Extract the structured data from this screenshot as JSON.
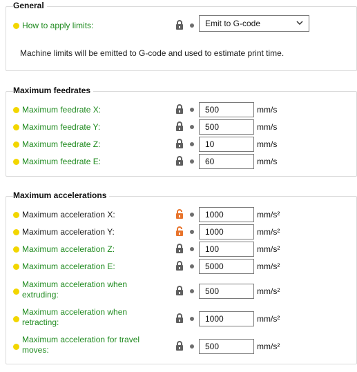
{
  "general": {
    "title": "General",
    "apply_limits_label": "How to apply limits:",
    "apply_limits_value": "Emit to G-code",
    "info_text": "Machine limits will be emitted to G-code and used to estimate print time."
  },
  "feedrates": {
    "title": "Maximum feedrates",
    "unit": "mm/s",
    "rows": [
      {
        "label": "Maximum feedrate X:",
        "value": "500"
      },
      {
        "label": "Maximum feedrate Y:",
        "value": "500"
      },
      {
        "label": "Maximum feedrate Z:",
        "value": "10"
      },
      {
        "label": "Maximum feedrate E:",
        "value": "60"
      }
    ]
  },
  "accelerations": {
    "title": "Maximum accelerations",
    "unit": "mm/s²",
    "rows": [
      {
        "label": "Maximum acceleration X:",
        "value": "1000",
        "modified": true
      },
      {
        "label": "Maximum acceleration Y:",
        "value": "1000",
        "modified": true
      },
      {
        "label": "Maximum acceleration Z:",
        "value": "100",
        "modified": false
      },
      {
        "label": "Maximum acceleration E:",
        "value": "5000",
        "modified": false
      },
      {
        "label_line1": "Maximum acceleration when",
        "label_line2": "extruding:",
        "value": "500",
        "modified": false
      },
      {
        "label_line1": "Maximum acceleration when",
        "label_line2": "retracting:",
        "value": "1000",
        "modified": false
      },
      {
        "label_line1": "Maximum acceleration for travel",
        "label_line2": "moves:",
        "value": "500",
        "modified": false
      }
    ]
  },
  "colors": {
    "system_label": "#1e8a1e",
    "modified_label": "#1a1a1a",
    "bullet": "#f2d600",
    "lock_locked": "#5f5f5f",
    "lock_unlocked": "#e8742c"
  },
  "icons": {
    "locked": "lock-icon",
    "unlocked": "unlock-icon",
    "bullet": "bullet-icon",
    "dropdown": "chevron-down-icon"
  }
}
